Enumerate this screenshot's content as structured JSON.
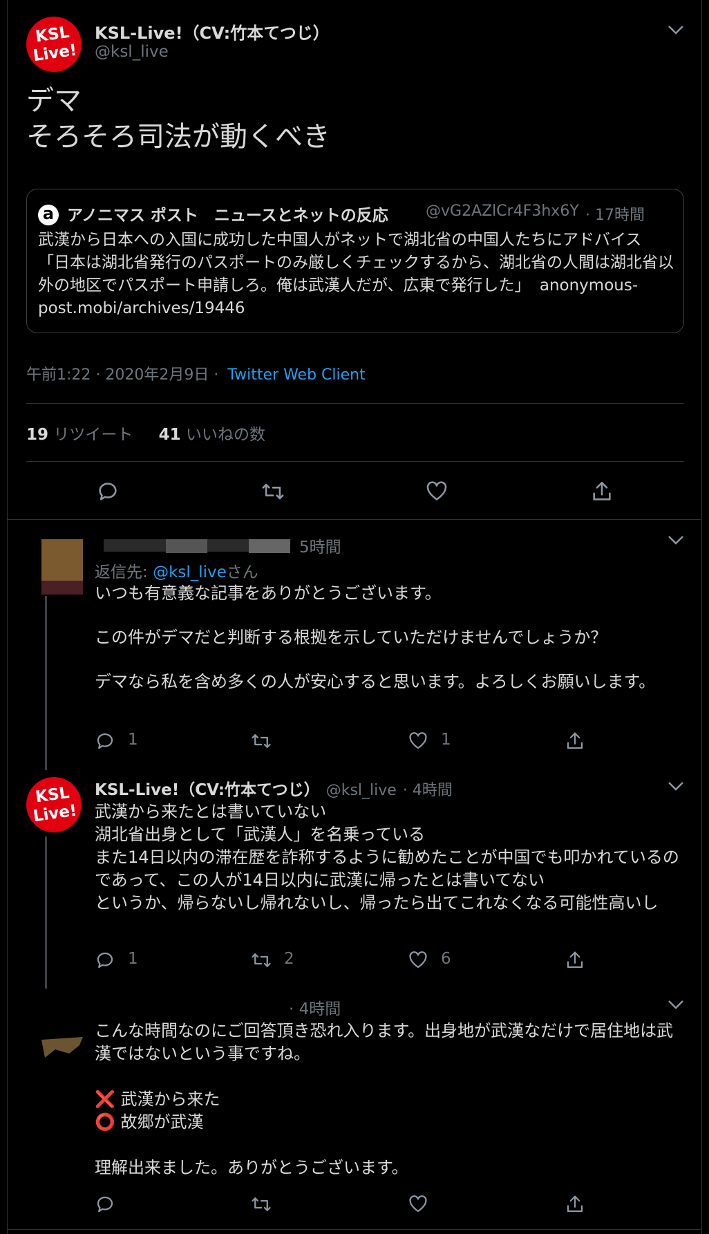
{
  "main_tweet": {
    "author_name": "KSL-Live!（CV:竹本てつじ）",
    "author_handle": "@ksl_live",
    "avatar_text": "KSL Live!",
    "text_line1": "デマ",
    "text_line2": "そろそろ司法が動くべき",
    "quote": {
      "icon_letter": "a",
      "source_name": "アノニマス ポスト　ニュースとネットの反応",
      "source_handle": "@vG2AZlCr4F3hx6Y",
      "time": "· 17時間",
      "text": "武漢から日本への入国に成功した中国人がネットで湖北省の中国人たちにアドバイス　「日本は湖北省発行のパスポートのみ厳しくチェックするから、湖北省の人間は湖北省以外の地区でパスポート申請しろ。俺は武漢人だが、広東で発行した」",
      "link": "anonymous-post.mobi/archives/19446"
    },
    "timestamp": "午前1:22 · 2020年2月9日 ·",
    "client": "Twitter Web Client",
    "retweet_count": "19",
    "retweet_label": "リツイート",
    "like_count": "41",
    "like_label": "いいねの数"
  },
  "replies": [
    {
      "time": "5時間",
      "reply_to_prefix": "返信先:",
      "reply_to_handle": "@ksl_live",
      "reply_to_suffix": "さん",
      "text": "いつも有意義な記事をありがとうございます。\n\nこの件がデマだと判断する根拠を示していただけませんでしょうか？\n\nデマなら私を含め多くの人が安心すると思います。よろしくお願いします。",
      "reply_count": "1",
      "retweet_count": "",
      "like_count": "1"
    },
    {
      "author_name": "KSL-Live!（CV:竹本てつじ）",
      "author_handle": "@ksl_live",
      "time": "· 4時間",
      "avatar_text": "KSL Live!",
      "text": "武漢から来たとは書いていない\n湖北省出身として「武漢人」を名乗っている\nまた14日以内の滞在歴を詐称するように勧めたことが中国でも叩かれているのであって、この人が14日以内に武漢に帰ったとは書いてない\nというか、帰らないし帰れないし、帰ったら出てこれなくなる可能性高いし",
      "reply_count": "1",
      "retweet_count": "2",
      "like_count": "6"
    },
    {
      "time": "· 4時間",
      "text": "こんな時間なのにご回答頂き恐れ入ります。出身地が武漢なだけで居住地は武漢ではないという事ですね。",
      "mark_x": "❌",
      "line_x": "武漢から来た",
      "mark_o": "⭕",
      "line_o": "故郷が武漢",
      "closing": "理解出来ました。ありがとうございます。"
    }
  ],
  "colors": {
    "background": "#000000",
    "text": "#d9d9d9",
    "secondary": "#6e767d",
    "accent": "#1da1f2",
    "avatar_red": "#e0000f"
  }
}
